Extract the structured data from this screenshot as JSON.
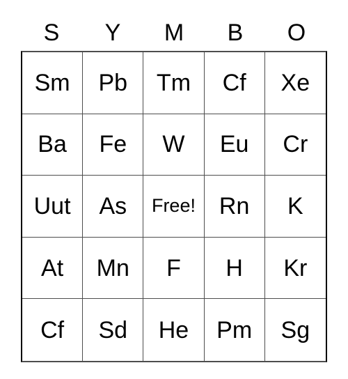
{
  "card": {
    "header_letters": [
      "S",
      "Y",
      "M",
      "B",
      "O"
    ],
    "free_space_label": "Free!",
    "columns": 5,
    "rows": 5,
    "text_color": "#000000",
    "border_color": "#4d4d4d",
    "background_color": "#ffffff",
    "grid": [
      [
        "Sm",
        "Pb",
        "Tm",
        "Cf",
        "Xe"
      ],
      [
        "Ba",
        "Fe",
        "W",
        "Eu",
        "Cr"
      ],
      [
        "Uut",
        "As",
        "Free!",
        "Rn",
        "K"
      ],
      [
        "At",
        "Mn",
        "F",
        "H",
        "Kr"
      ],
      [
        "Cf",
        "Sd",
        "He",
        "Pm",
        "Sg"
      ]
    ]
  }
}
